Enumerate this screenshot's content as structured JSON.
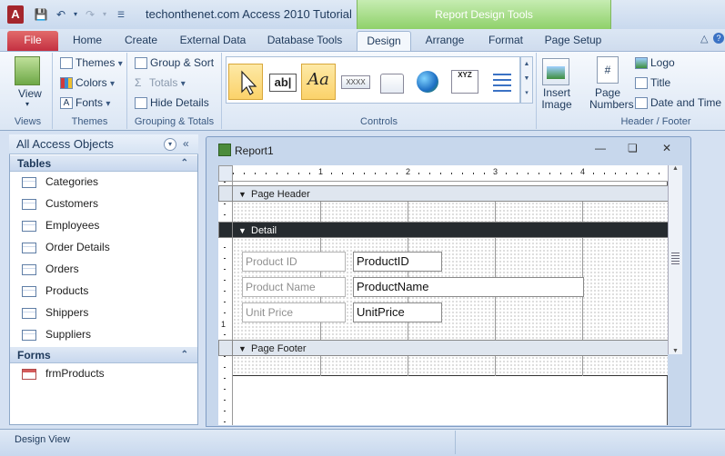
{
  "app": {
    "title": "techonthenet.com Access 2010 Tutorial",
    "contextual_title": "Report Design Tools",
    "logo_letter": "A"
  },
  "tabs": {
    "file": "File",
    "home": "Home",
    "create": "Create",
    "external_data": "External Data",
    "database_tools": "Database Tools",
    "design": "Design",
    "arrange": "Arrange",
    "format": "Format",
    "page_setup": "Page Setup"
  },
  "ribbon": {
    "views": {
      "view_label": "View",
      "group_label": "Views"
    },
    "themes": {
      "themes_label": "Themes",
      "colors_label": "Colors",
      "fonts_label": "Fonts",
      "group_label": "Themes"
    },
    "grouping": {
      "group_sort_label": "Group & Sort",
      "totals_label": "Totals",
      "hide_details_label": "Hide Details",
      "group_label": "Grouping & Totals"
    },
    "controls": {
      "group_label": "Controls",
      "textbox_glyph": "ab|",
      "label_glyph": "Aa",
      "button_glyph": "XXXX",
      "chart_glyph": "XYZ",
      "insert_image_label": "Insert\nImage"
    },
    "header_footer": {
      "page_numbers_label": "Page\nNumbers",
      "logo_label": "Logo",
      "title_label": "Title",
      "date_time_label": "Date and Time",
      "group_label": "Header / Footer"
    }
  },
  "nav": {
    "title": "All Access Objects",
    "tables_header": "Tables",
    "tables": [
      "Categories",
      "Customers",
      "Employees",
      "Order Details",
      "Orders",
      "Products",
      "Shippers",
      "Suppliers"
    ],
    "forms_header": "Forms",
    "forms": [
      "frmProducts"
    ]
  },
  "report": {
    "title": "Report1",
    "ruler_marks": [
      "1",
      "2",
      "3",
      "4"
    ],
    "vruler_mark": "1",
    "page_header": "Page Header",
    "detail": "Detail",
    "page_footer": "Page Footer",
    "fields": [
      {
        "label": "Product ID",
        "value": "ProductID"
      },
      {
        "label": "Product Name",
        "value": "ProductName"
      },
      {
        "label": "Unit Price",
        "value": "UnitPrice"
      }
    ]
  },
  "status": {
    "text": "Design View"
  },
  "colors": {
    "file_tab": "#c43041",
    "contextual": "#8fd16a",
    "detail_band": "#262b2f"
  }
}
